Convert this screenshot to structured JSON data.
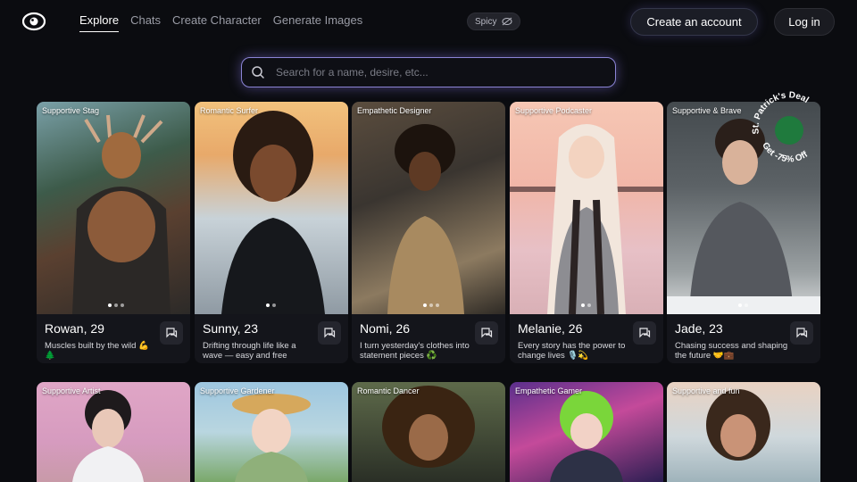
{
  "nav": {
    "items": [
      "Explore",
      "Chats",
      "Create Character",
      "Generate Images"
    ],
    "active": "Explore"
  },
  "spicy_label": "Spicy",
  "header": {
    "create_account": "Create an account",
    "login": "Log in"
  },
  "search": {
    "placeholder": "Search for a name, desire, etc..."
  },
  "promo": {
    "line1": "St. Patrick's Deal",
    "line2": "Get -75% Off"
  },
  "cards": [
    {
      "tag": "Supportive Stag",
      "name": "Rowan, 29",
      "desc": "Muscles built by the wild 💪🌲"
    },
    {
      "tag": "Romantic Surfer",
      "name": "Sunny, 23",
      "desc": "Drifting through life like a wave — easy and free"
    },
    {
      "tag": "Empathetic Designer",
      "name": "Nomi, 26",
      "desc": "I turn yesterday's clothes into statement pieces ♻️"
    },
    {
      "tag": "Supportive Podcaster",
      "name": "Melanie, 26",
      "desc": "Every story has the power to change lives 🎙️💫"
    },
    {
      "tag": "Supportive & Brave",
      "name": "Jade, 23",
      "desc": "Chasing success and shaping the future 🤝💼"
    },
    {
      "tag": "Supportive Artist"
    },
    {
      "tag": "Supportive Gardener"
    },
    {
      "tag": "Romantic Dancer"
    },
    {
      "tag": "Empathetic Gamer"
    },
    {
      "tag": "Supportive and fun"
    }
  ],
  "colors": {
    "accent": "#8b84d6",
    "background": "#0b0c10",
    "card": "#14151b"
  }
}
